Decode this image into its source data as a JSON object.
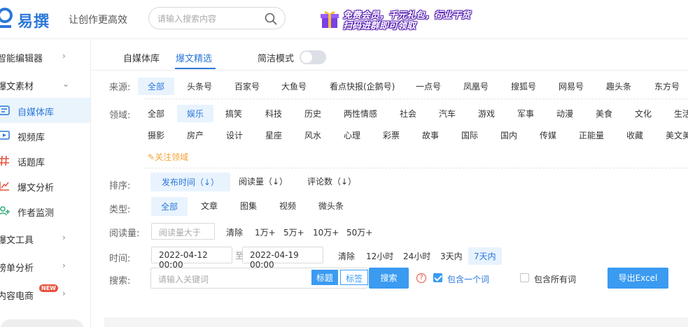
{
  "header": {
    "logo_text": "易撰",
    "slogan": "让创作更高效",
    "search_placeholder": "请输入搜索内容",
    "banner_line1": "免费会员，千元礼包，行业干货",
    "banner_line2": "扫码进群即可领取"
  },
  "sidebar": {
    "items": [
      {
        "label": "智能编辑器",
        "arrow": "›"
      },
      {
        "label": "爆文素材",
        "arrow": "⌄"
      },
      {
        "label": "自媒体库",
        "icon": "self-media-icon"
      },
      {
        "label": "视频库",
        "icon": "video-icon"
      },
      {
        "label": "话题库",
        "icon": "hashtag-icon"
      },
      {
        "label": "爆文分析",
        "icon": "analysis-icon"
      },
      {
        "label": "作者监测",
        "icon": "user-add-icon"
      },
      {
        "label": "爆文工具",
        "arrow": "›"
      },
      {
        "label": "榜单分析",
        "arrow": "›"
      },
      {
        "label": "内容电商",
        "arrow": "›",
        "badge": "NEW"
      }
    ]
  },
  "tabs": {
    "items": [
      "自媒体库",
      "爆文精选"
    ],
    "active": "爆文精选",
    "simple_mode_label": "简洁模式"
  },
  "filters": {
    "source_label": "来源:",
    "sources": [
      "全部",
      "头条号",
      "百家号",
      "大鱼号",
      "看点快报(企鹅号)",
      "一点号",
      "凤凰号",
      "搜狐号",
      "网易号",
      "趣头条",
      "东方号"
    ],
    "domain_label": "领域:",
    "domains_row1": [
      "全部",
      "娱乐",
      "搞笑",
      "科技",
      "历史",
      "两性情感",
      "社会",
      "汽车",
      "游戏",
      "军事",
      "动漫",
      "美食",
      "文化",
      "生活"
    ],
    "domains_row2": [
      "摄影",
      "房产",
      "设计",
      "星座",
      "风水",
      "心理",
      "彩票",
      "故事",
      "国际",
      "国内",
      "传媒",
      "正能量",
      "收藏",
      "美文美"
    ],
    "follow_domain": "关注领域",
    "sort_label": "排序:",
    "sorts": [
      "发布时间（↓）",
      "阅读量（↓）",
      "评论数（↓）"
    ],
    "type_label": "类型:",
    "types": [
      "全部",
      "文章",
      "图集",
      "视频",
      "微头条"
    ],
    "read_label": "阅读量:",
    "read_placeholder": "阅读量大于",
    "read_options": [
      "清除",
      "1万+",
      "5万+",
      "10万+",
      "50万+"
    ],
    "time_label": "时间:",
    "time_start": "2022-04-12 00:00",
    "time_sep": "至",
    "time_end": "2022-04-19 00:00",
    "time_options": [
      "清除",
      "12小时",
      "24小时",
      "3天内",
      "7天内"
    ],
    "search_label": "搜索:",
    "keyword_placeholder": "请输入关键词",
    "seg_title": "标题",
    "seg_tag": "标签",
    "search_button": "搜索",
    "help": "?",
    "contains_one": "包含一个词",
    "contains_all": "包含所有词",
    "export_button": "导出Excel"
  }
}
